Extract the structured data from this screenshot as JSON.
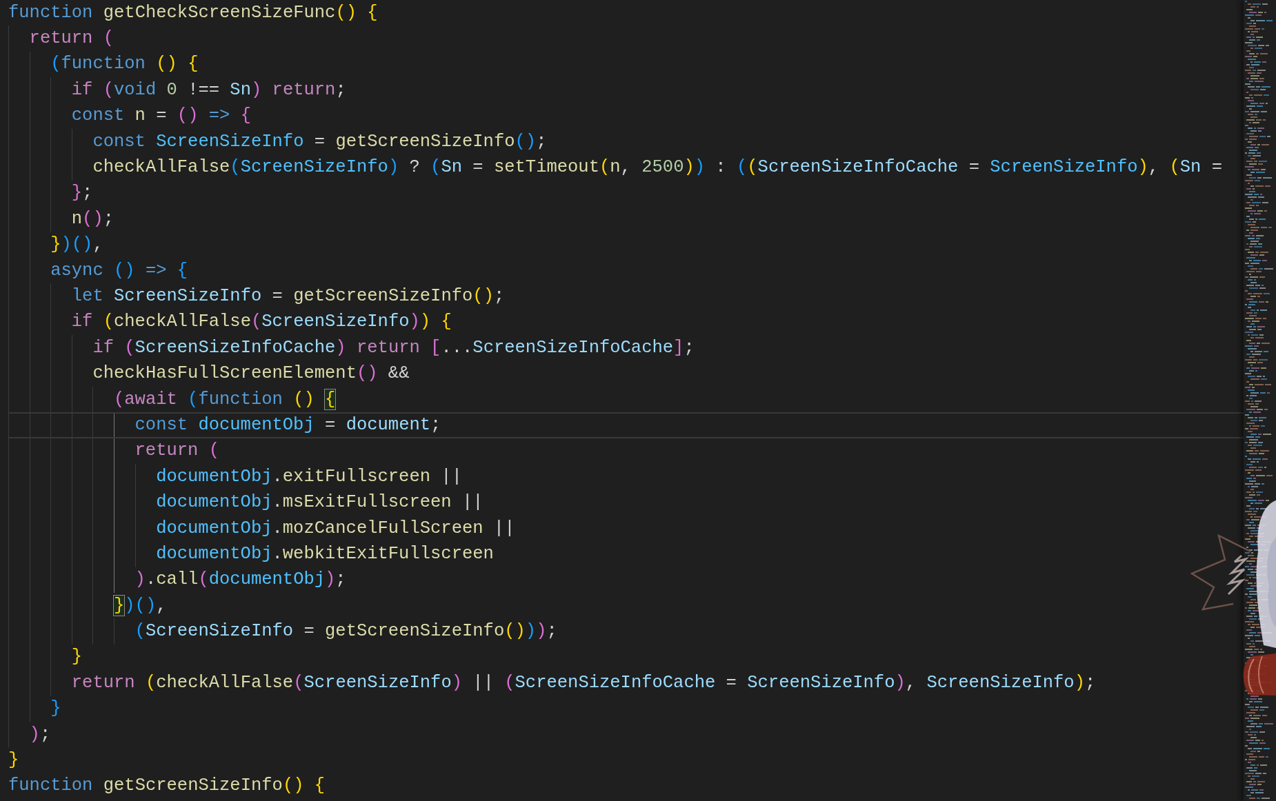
{
  "editor": {
    "lines": [
      {
        "current": false,
        "tokens": [
          {
            "text": "function ",
            "kind": "keyword"
          },
          {
            "text": "getCheckScreenSizeFunc",
            "kind": "function"
          },
          {
            "text": "() ",
            "kind": "bracket1"
          },
          {
            "text": "{",
            "kind": "bracket1"
          }
        ],
        "children": [
          {
            "current": false,
            "tokens": [
              {
                "text": "return ",
                "kind": "control"
              },
              {
                "text": "(",
                "kind": "bracket2"
              }
            ],
            "children": [
              {
                "current": false,
                "tokens": [
                  {
                    "text": "(",
                    "kind": "bracket3"
                  },
                  {
                    "text": "function ",
                    "kind": "keyword"
                  },
                  {
                    "text": "() ",
                    "kind": "bracket1"
                  },
                  {
                    "text": "{",
                    "kind": "bracket1"
                  }
                ],
                "children": [
                  {
                    "current": false,
                    "tokens": [
                      {
                        "text": "if ",
                        "kind": "control"
                      },
                      {
                        "text": "(",
                        "kind": "bracket2"
                      },
                      {
                        "text": "void ",
                        "kind": "keyword"
                      },
                      {
                        "text": "0",
                        "kind": "number"
                      },
                      {
                        "text": " !== ",
                        "kind": "plain"
                      },
                      {
                        "text": "Sn",
                        "kind": "variable"
                      },
                      {
                        "text": ") ",
                        "kind": "bracket2"
                      },
                      {
                        "text": "return",
                        "kind": "control"
                      },
                      {
                        "text": ";",
                        "kind": "plain"
                      }
                    ]
                  },
                  {
                    "current": false,
                    "tokens": [
                      {
                        "text": "const ",
                        "kind": "keyword"
                      },
                      {
                        "text": "n",
                        "kind": "function"
                      },
                      {
                        "text": " = ",
                        "kind": "plain"
                      },
                      {
                        "text": "() ",
                        "kind": "bracket2"
                      },
                      {
                        "text": "=> ",
                        "kind": "keyword"
                      },
                      {
                        "text": "{",
                        "kind": "bracket2"
                      }
                    ],
                    "children": [
                      {
                        "current": false,
                        "tokens": [
                          {
                            "text": "const ",
                            "kind": "keyword"
                          },
                          {
                            "text": "ScreenSizeInfo",
                            "kind": "constant"
                          },
                          {
                            "text": " = ",
                            "kind": "plain"
                          },
                          {
                            "text": "getScreenSizeInfo",
                            "kind": "function"
                          },
                          {
                            "text": "()",
                            "kind": "bracket3"
                          },
                          {
                            "text": ";",
                            "kind": "plain"
                          }
                        ]
                      },
                      {
                        "current": false,
                        "tokens": [
                          {
                            "text": "checkAllFalse",
                            "kind": "function"
                          },
                          {
                            "text": "(",
                            "kind": "bracket3"
                          },
                          {
                            "text": "ScreenSizeInfo",
                            "kind": "constant"
                          },
                          {
                            "text": ")",
                            "kind": "bracket3"
                          },
                          {
                            "text": " ? ",
                            "kind": "plain"
                          },
                          {
                            "text": "(",
                            "kind": "bracket3"
                          },
                          {
                            "text": "Sn",
                            "kind": "variable"
                          },
                          {
                            "text": " = ",
                            "kind": "plain"
                          },
                          {
                            "text": "setTimeout",
                            "kind": "function"
                          },
                          {
                            "text": "(",
                            "kind": "bracket1"
                          },
                          {
                            "text": "n",
                            "kind": "function"
                          },
                          {
                            "text": ", ",
                            "kind": "plain"
                          },
                          {
                            "text": "2500",
                            "kind": "number"
                          },
                          {
                            "text": ")",
                            "kind": "bracket1"
                          },
                          {
                            "text": ")",
                            "kind": "bracket3"
                          },
                          {
                            "text": " : ",
                            "kind": "plain"
                          },
                          {
                            "text": "(",
                            "kind": "bracket3"
                          },
                          {
                            "text": "(",
                            "kind": "bracket1"
                          },
                          {
                            "text": "ScreenSizeInfoCache",
                            "kind": "variable"
                          },
                          {
                            "text": " = ",
                            "kind": "plain"
                          },
                          {
                            "text": "ScreenSizeInfo",
                            "kind": "constant"
                          },
                          {
                            "text": ")",
                            "kind": "bracket1"
                          },
                          {
                            "text": ", ",
                            "kind": "plain"
                          },
                          {
                            "text": "(",
                            "kind": "bracket1"
                          },
                          {
                            "text": "Sn",
                            "kind": "variable"
                          },
                          {
                            "text": " =",
                            "kind": "plain"
                          }
                        ]
                      }
                    ]
                  },
                  {
                    "current": false,
                    "tokens": [
                      {
                        "text": "}",
                        "kind": "bracket2"
                      },
                      {
                        "text": ";",
                        "kind": "plain"
                      }
                    ]
                  },
                  {
                    "current": false,
                    "tokens": [
                      {
                        "text": "n",
                        "kind": "function"
                      },
                      {
                        "text": "()",
                        "kind": "bracket2"
                      },
                      {
                        "text": ";",
                        "kind": "plain"
                      }
                    ]
                  }
                ]
              },
              {
                "current": false,
                "tokens": [
                  {
                    "text": "}",
                    "kind": "bracket1"
                  },
                  {
                    "text": ")()",
                    "kind": "bracket3"
                  },
                  {
                    "text": ",",
                    "kind": "plain"
                  }
                ]
              },
              {
                "current": false,
                "tokens": [
                  {
                    "text": "async ",
                    "kind": "keyword"
                  },
                  {
                    "text": "() ",
                    "kind": "bracket3"
                  },
                  {
                    "text": "=> ",
                    "kind": "keyword"
                  },
                  {
                    "text": "{",
                    "kind": "bracket3"
                  }
                ],
                "children": [
                  {
                    "current": false,
                    "tokens": [
                      {
                        "text": "let ",
                        "kind": "keyword"
                      },
                      {
                        "text": "ScreenSizeInfo",
                        "kind": "variable"
                      },
                      {
                        "text": " = ",
                        "kind": "plain"
                      },
                      {
                        "text": "getScreenSizeInfo",
                        "kind": "function"
                      },
                      {
                        "text": "()",
                        "kind": "bracket1"
                      },
                      {
                        "text": ";",
                        "kind": "plain"
                      }
                    ]
                  },
                  {
                    "current": false,
                    "tokens": [
                      {
                        "text": "if ",
                        "kind": "control"
                      },
                      {
                        "text": "(",
                        "kind": "bracket1"
                      },
                      {
                        "text": "checkAllFalse",
                        "kind": "function"
                      },
                      {
                        "text": "(",
                        "kind": "bracket2"
                      },
                      {
                        "text": "ScreenSizeInfo",
                        "kind": "variable"
                      },
                      {
                        "text": ")",
                        "kind": "bracket2"
                      },
                      {
                        "text": ") ",
                        "kind": "bracket1"
                      },
                      {
                        "text": "{",
                        "kind": "bracket1"
                      }
                    ],
                    "children": [
                      {
                        "current": false,
                        "tokens": [
                          {
                            "text": "if ",
                            "kind": "control"
                          },
                          {
                            "text": "(",
                            "kind": "bracket2"
                          },
                          {
                            "text": "ScreenSizeInfoCache",
                            "kind": "variable"
                          },
                          {
                            "text": ") ",
                            "kind": "bracket2"
                          },
                          {
                            "text": "return ",
                            "kind": "control"
                          },
                          {
                            "text": "[",
                            "kind": "bracket2"
                          },
                          {
                            "text": "...",
                            "kind": "plain"
                          },
                          {
                            "text": "ScreenSizeInfoCache",
                            "kind": "variable"
                          },
                          {
                            "text": "]",
                            "kind": "bracket2"
                          },
                          {
                            "text": ";",
                            "kind": "plain"
                          }
                        ]
                      },
                      {
                        "current": false,
                        "tokens": [
                          {
                            "text": "checkHasFullScreenElement",
                            "kind": "function"
                          },
                          {
                            "text": "()",
                            "kind": "bracket2"
                          },
                          {
                            "text": " &&",
                            "kind": "plain"
                          }
                        ],
                        "children": [
                          {
                            "current": false,
                            "tokens": [
                              {
                                "text": "(",
                                "kind": "bracket2"
                              },
                              {
                                "text": "await ",
                                "kind": "control"
                              },
                              {
                                "text": "(",
                                "kind": "bracket3"
                              },
                              {
                                "text": "function ",
                                "kind": "keyword"
                              },
                              {
                                "text": "() ",
                                "kind": "bracket1"
                              },
                              {
                                "text": "{",
                                "kind": "bracket1matched"
                              }
                            ],
                            "children": [
                              {
                                "current": true,
                                "tokens": [
                                  {
                                    "text": "const ",
                                    "kind": "keyword"
                                  },
                                  {
                                    "text": "documentObj",
                                    "kind": "constant"
                                  },
                                  {
                                    "text": " = ",
                                    "kind": "plain"
                                  },
                                  {
                                    "text": "document",
                                    "kind": "variable"
                                  },
                                  {
                                    "text": ";",
                                    "kind": "plain"
                                  }
                                ]
                              },
                              {
                                "current": false,
                                "tokens": [
                                  {
                                    "text": "return ",
                                    "kind": "control"
                                  },
                                  {
                                    "text": "(",
                                    "kind": "bracket2"
                                  }
                                ],
                                "children": [
                                  {
                                    "current": false,
                                    "tokens": [
                                      {
                                        "text": "documentObj",
                                        "kind": "constant"
                                      },
                                      {
                                        "text": ".",
                                        "kind": "plain"
                                      },
                                      {
                                        "text": "exitFullscreen",
                                        "kind": "function"
                                      },
                                      {
                                        "text": " ||",
                                        "kind": "plain"
                                      }
                                    ]
                                  },
                                  {
                                    "current": false,
                                    "tokens": [
                                      {
                                        "text": "documentObj",
                                        "kind": "constant"
                                      },
                                      {
                                        "text": ".",
                                        "kind": "plain"
                                      },
                                      {
                                        "text": "msExitFullscreen",
                                        "kind": "function"
                                      },
                                      {
                                        "text": " ||",
                                        "kind": "plain"
                                      }
                                    ]
                                  },
                                  {
                                    "current": false,
                                    "tokens": [
                                      {
                                        "text": "documentObj",
                                        "kind": "constant"
                                      },
                                      {
                                        "text": ".",
                                        "kind": "plain"
                                      },
                                      {
                                        "text": "mozCancelFullScreen",
                                        "kind": "function"
                                      },
                                      {
                                        "text": " ||",
                                        "kind": "plain"
                                      }
                                    ]
                                  },
                                  {
                                    "current": false,
                                    "tokens": [
                                      {
                                        "text": "documentObj",
                                        "kind": "constant"
                                      },
                                      {
                                        "text": ".",
                                        "kind": "plain"
                                      },
                                      {
                                        "text": "webkitExitFullscreen",
                                        "kind": "function"
                                      }
                                    ]
                                  }
                                ]
                              },
                              {
                                "current": false,
                                "tokens": [
                                  {
                                    "text": ")",
                                    "kind": "bracket2"
                                  },
                                  {
                                    "text": ".",
                                    "kind": "plain"
                                  },
                                  {
                                    "text": "call",
                                    "kind": "function"
                                  },
                                  {
                                    "text": "(",
                                    "kind": "bracket2"
                                  },
                                  {
                                    "text": "documentObj",
                                    "kind": "constant"
                                  },
                                  {
                                    "text": ")",
                                    "kind": "bracket2"
                                  },
                                  {
                                    "text": ";",
                                    "kind": "plain"
                                  }
                                ]
                              }
                            ]
                          },
                          {
                            "current": false,
                            "tokens": [
                              {
                                "text": "}",
                                "kind": "bracket1matched"
                              },
                              {
                                "text": ")()",
                                "kind": "bracket3"
                              },
                              {
                                "text": ",",
                                "kind": "plain"
                              }
                            ],
                            "children": [
                              {
                                "current": false,
                                "tokens": [
                                  {
                                    "text": "(",
                                    "kind": "bracket3"
                                  },
                                  {
                                    "text": "ScreenSizeInfo",
                                    "kind": "variable"
                                  },
                                  {
                                    "text": " = ",
                                    "kind": "plain"
                                  },
                                  {
                                    "text": "getScreenSizeInfo",
                                    "kind": "function"
                                  },
                                  {
                                    "text": "()",
                                    "kind": "bracket1"
                                  },
                                  {
                                    "text": ")",
                                    "kind": "bracket3"
                                  },
                                  {
                                    "text": ")",
                                    "kind": "bracket2"
                                  },
                                  {
                                    "text": ";",
                                    "kind": "plain"
                                  }
                                ]
                              }
                            ]
                          }
                        ]
                      }
                    ]
                  },
                  {
                    "current": false,
                    "tokens": [
                      {
                        "text": "}",
                        "kind": "bracket1"
                      }
                    ]
                  },
                  {
                    "current": false,
                    "tokens": [
                      {
                        "text": "return ",
                        "kind": "control"
                      },
                      {
                        "text": "(",
                        "kind": "bracket1"
                      },
                      {
                        "text": "checkAllFalse",
                        "kind": "function"
                      },
                      {
                        "text": "(",
                        "kind": "bracket2"
                      },
                      {
                        "text": "ScreenSizeInfo",
                        "kind": "variable"
                      },
                      {
                        "text": ")",
                        "kind": "bracket2"
                      },
                      {
                        "text": " || ",
                        "kind": "plain"
                      },
                      {
                        "text": "(",
                        "kind": "bracket2"
                      },
                      {
                        "text": "ScreenSizeInfoCache",
                        "kind": "variable"
                      },
                      {
                        "text": " = ",
                        "kind": "plain"
                      },
                      {
                        "text": "ScreenSizeInfo",
                        "kind": "variable"
                      },
                      {
                        "text": ")",
                        "kind": "bracket2"
                      },
                      {
                        "text": ", ",
                        "kind": "plain"
                      },
                      {
                        "text": "ScreenSizeInfo",
                        "kind": "variable"
                      },
                      {
                        "text": ")",
                        "kind": "bracket1"
                      },
                      {
                        "text": ";",
                        "kind": "plain"
                      }
                    ]
                  }
                ]
              },
              {
                "current": false,
                "tokens": [
                  {
                    "text": "}",
                    "kind": "bracket3"
                  }
                ]
              }
            ]
          },
          {
            "current": false,
            "tokens": [
              {
                "text": ")",
                "kind": "bracket2"
              },
              {
                "text": ";",
                "kind": "plain"
              }
            ]
          }
        ]
      },
      {
        "current": false,
        "tokens": [
          {
            "text": "}",
            "kind": "bracket1"
          }
        ]
      },
      {
        "current": false,
        "tokens": [
          {
            "text": "function ",
            "kind": "keyword"
          },
          {
            "text": "getScreenSizeInfo",
            "kind": "function"
          },
          {
            "text": "() ",
            "kind": "bracket1"
          },
          {
            "text": "{",
            "kind": "bracket1"
          }
        ]
      }
    ]
  }
}
